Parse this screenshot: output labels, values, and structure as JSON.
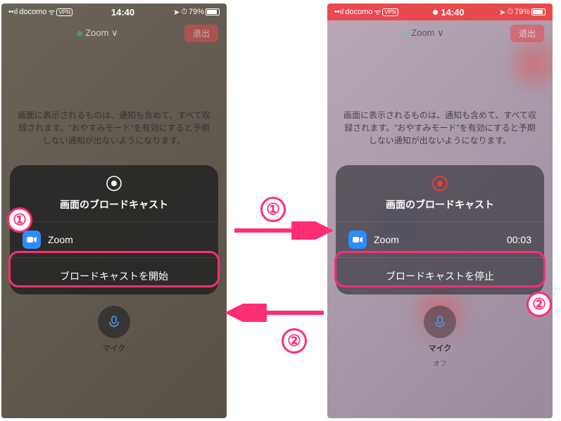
{
  "statusBar": {
    "carrier": "docomo",
    "wifi": "ᯤ",
    "vpn": "VPN",
    "time": "14:40",
    "alarm": "⏰",
    "battery": "79%",
    "nav": "➤"
  },
  "app": {
    "title": "Zoom ∨",
    "exit": "退出"
  },
  "infoText": "画面に表示されるものは、通知も含めて、すべて収録されます。\"おやすみモード\"を有効にすると予期しない通知が出ないようになります。",
  "broadcastCard": {
    "title": "画面のブロードキャスト",
    "zoomLabel": "Zoom",
    "timer": "00:03",
    "startLabel": "ブロードキャストを開始",
    "stopLabel": "ブロードキャストを停止"
  },
  "mic": {
    "label": "マイク",
    "state": "オフ"
  },
  "badge1": "①",
  "badge2": "②",
  "colors": {
    "pink": "#ff2d74",
    "red": "#e8494f",
    "zoomBlue": "#2d8cff"
  }
}
